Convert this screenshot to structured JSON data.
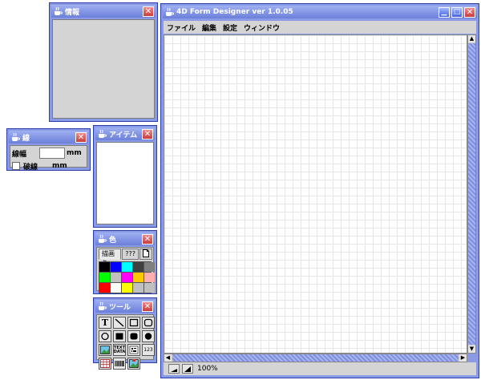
{
  "info_panel": {
    "title": "情報"
  },
  "line_panel": {
    "title": "線",
    "width_label": "線幅",
    "width_value": "",
    "width_unit": "mm",
    "dashed_label": "破線",
    "dashed_unit": "mm"
  },
  "item_panel": {
    "title": "アイテム"
  },
  "color_panel": {
    "title": "色",
    "tabs": [
      "描画色",
      "???"
    ],
    "swatches": [
      "#000000",
      "#0000ff",
      "#00ffff",
      "#404040",
      "#808080",
      "#00ff00",
      "#c0c0c0",
      "#ff00ff",
      "#ffc800",
      "#ffafaf",
      "#ff0000",
      "#ffffff",
      "#ffff00",
      "#c0c0c0",
      "#c0c0c0"
    ]
  },
  "tool_panel": {
    "title": "ツール",
    "tools": [
      "text-tool",
      "line-tool",
      "rect-tool",
      "round-rect-tool",
      "ellipse-tool",
      "filled-rect-tool",
      "filled-round-rect-tool",
      "filled-ellipse-tool",
      "image-tool",
      "text-data-tool",
      "barcode-tool",
      "number-tool",
      "table-tool",
      "barcode-list-tool",
      "image-data-tool"
    ],
    "text_data_label": "TEXT DATA",
    "number_label": "123"
  },
  "main_window": {
    "title": "4D Form Designer ver 1.0.05",
    "menu": [
      "ファイル",
      "編集",
      "設定",
      "ウィンドウ"
    ],
    "zoom": "100%"
  }
}
